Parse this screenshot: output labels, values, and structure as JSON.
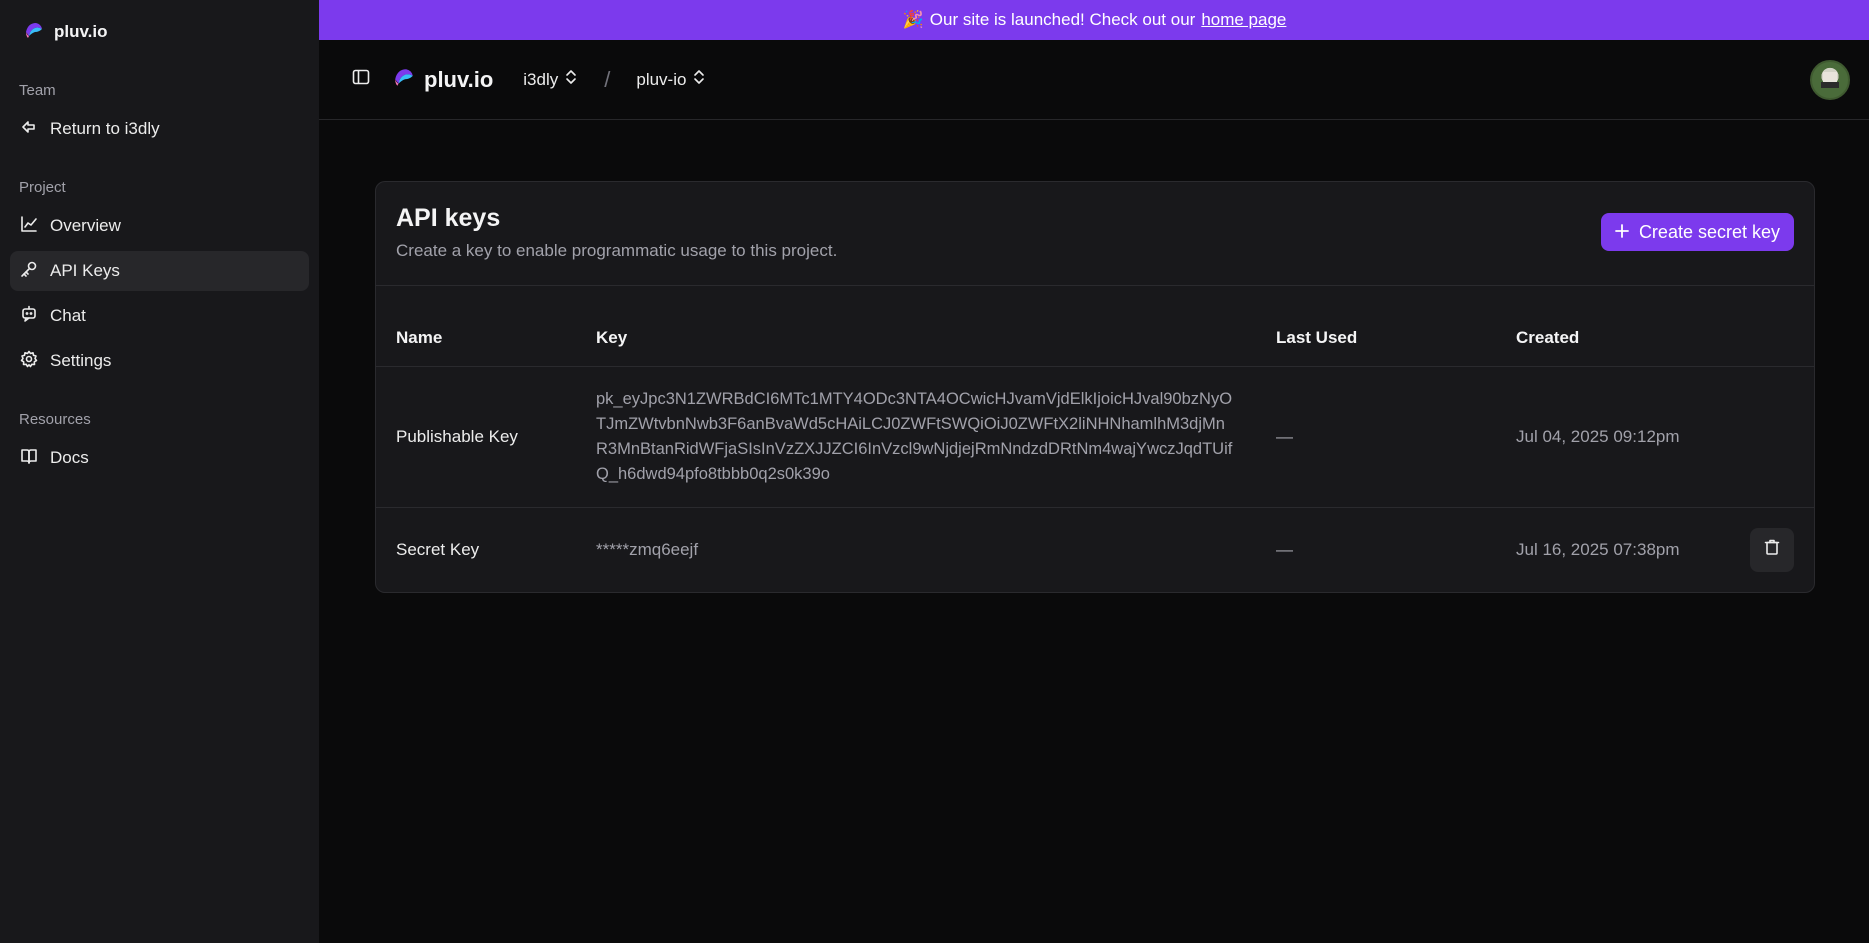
{
  "sidebar": {
    "brand": "pluv.io",
    "team_label": "Team",
    "return_label": "Return to i3dly",
    "project_label": "Project",
    "items": [
      {
        "label": "Overview",
        "icon": "chart-line-icon"
      },
      {
        "label": "API Keys",
        "icon": "key-icon"
      },
      {
        "label": "Chat",
        "icon": "chat-bot-icon"
      },
      {
        "label": "Settings",
        "icon": "gear-icon"
      }
    ],
    "resources_label": "Resources",
    "docs_label": "Docs"
  },
  "banner": {
    "emoji": "🎉",
    "text": "Our site is launched! Check out our",
    "link": "home page"
  },
  "topbar": {
    "brand": "pluv.io",
    "team": "i3dly",
    "separator": "/",
    "project": "pluv-io"
  },
  "card": {
    "title": "API keys",
    "subtitle": "Create a key to enable programmatic usage to this project.",
    "create_button": "Create secret key",
    "columns": [
      "Name",
      "Key",
      "Last Used",
      "Created"
    ],
    "rows": [
      {
        "name": "Publishable Key",
        "key": "pk_eyJpc3N1ZWRBdCI6MTc1MTY4ODc3NTA4OCwicHJvamVjdElkIjoicHJval90bzNyOTJmZWtvbnNwb3F6anBvaWd5cHAiLCJ0ZWFtSWQiOiJ0ZWFtX2liNHNhamlhM3djMnR3MnBtanRidWFjaSIsInVzZXJJZCI6InVzcl9wNjdjejRmNndzdDRtNm4wajYwczJqdTUifQ_h6dwd94pfo8tbbb0q2s0k39o",
        "last_used": "—",
        "created": "Jul 04, 2025 09:12pm"
      },
      {
        "name": "Secret Key",
        "key": "*****zmq6eejf",
        "last_used": "—",
        "created": "Jul 16, 2025 07:38pm"
      }
    ]
  },
  "colors": {
    "accent": "#7c3aed",
    "sidebar_bg": "#18181b",
    "page_bg": "#0a0a0b"
  }
}
